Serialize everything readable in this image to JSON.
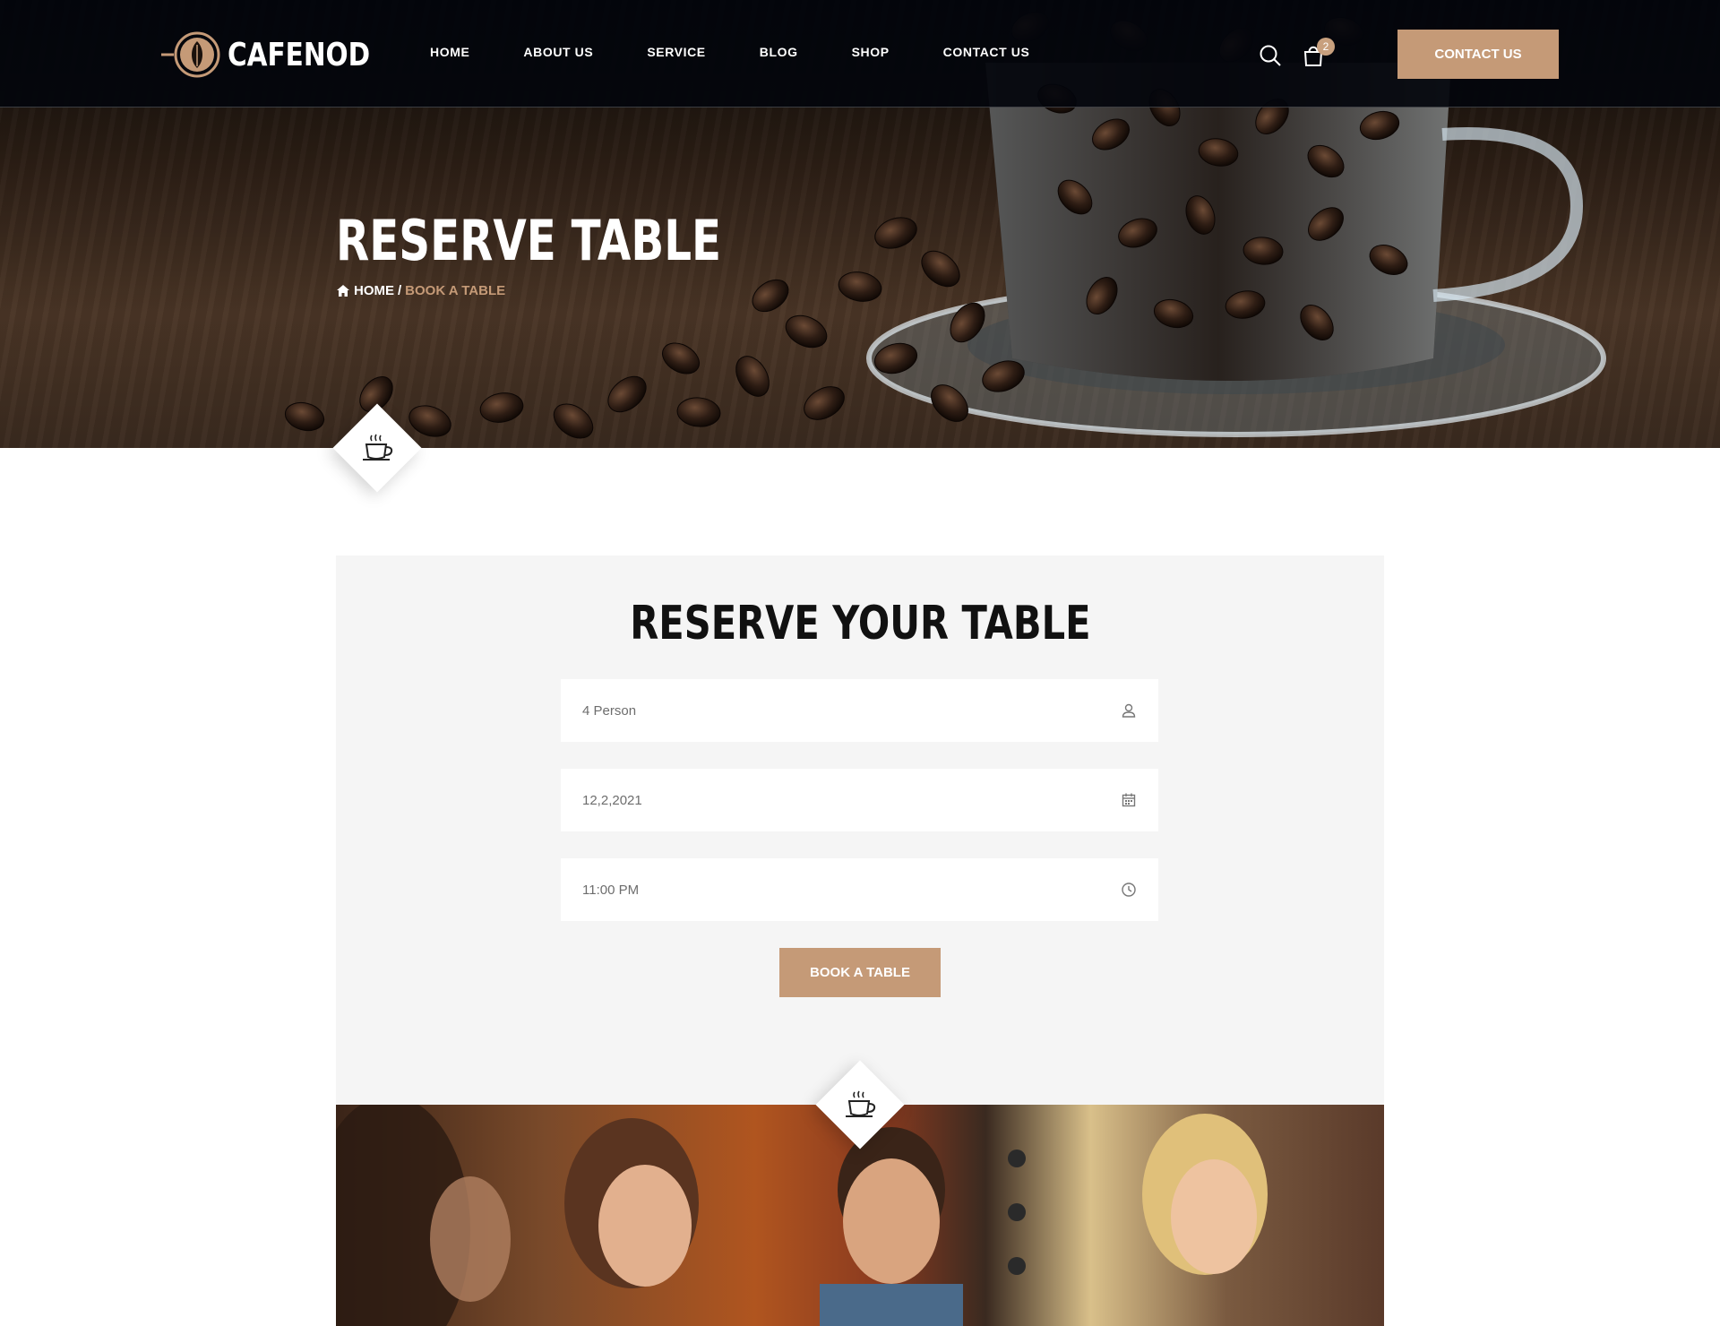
{
  "brand": {
    "name": "CAFENOD"
  },
  "nav": {
    "items": [
      "HOME",
      "ABOUT US",
      "SERVICE",
      "BLOG",
      "SHOP",
      "CONTACT US"
    ]
  },
  "header": {
    "cart_count": "2",
    "cta_label": "CONTACT US"
  },
  "hero": {
    "title": "RESERVE TABLE",
    "breadcrumb": {
      "home": "HOME",
      "separator": "/",
      "current": "BOOK A TABLE"
    }
  },
  "reservation": {
    "title": "RESERVE YOUR TABLE",
    "fields": {
      "persons": {
        "value": "4 Person",
        "icon": "user-icon"
      },
      "date": {
        "value": "12,2,2021",
        "icon": "calendar-icon"
      },
      "time": {
        "value": "11:00 PM",
        "icon": "clock-icon"
      }
    },
    "submit_label": "BOOK A TABLE"
  },
  "colors": {
    "accent": "#c59a77",
    "header_bg": "#03050c",
    "panel_bg": "#f5f5f5",
    "title_text": "#111111"
  }
}
